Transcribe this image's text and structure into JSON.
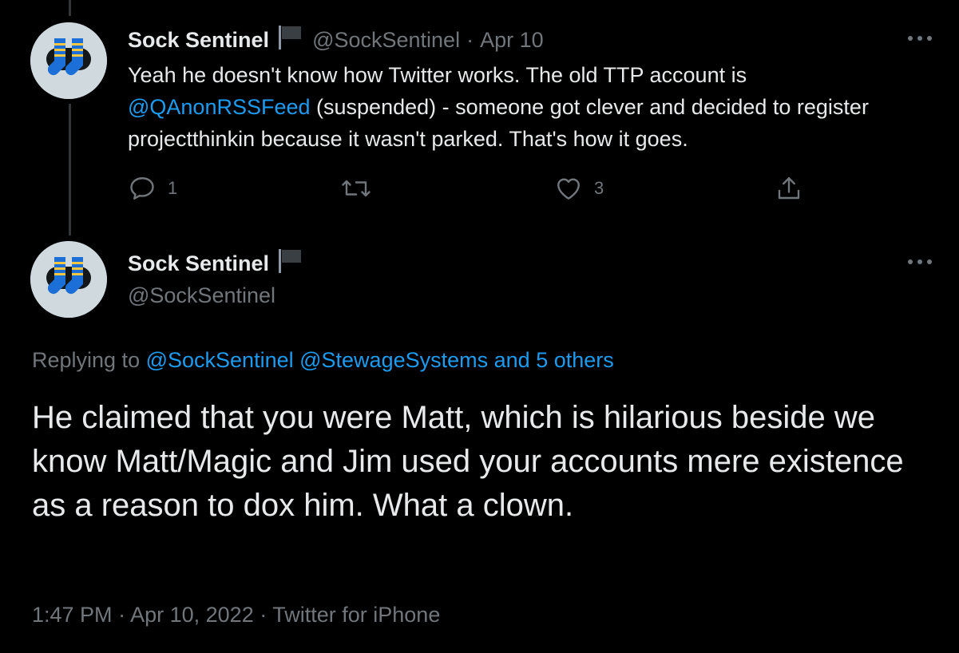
{
  "colors": {
    "background": "#000000",
    "text": "#e7e9ea",
    "muted": "#71767b",
    "link": "#1d9bf0",
    "thread_line": "#333639"
  },
  "tweet1": {
    "display_name": "Sock Sentinel",
    "handle": "@SockSentinel",
    "separator": "·",
    "date": "Apr 10",
    "text_line1": "Yeah he doesn't know how Twitter works. The old TTP account is",
    "mention": "@QAnonRSSFeed",
    "text_after_mention": " (suspended)  - someone got clever and decided to register projectthinkin because it wasn't parked.  That's how it goes.",
    "reply_count": "1",
    "retweet_count": "",
    "like_count": "3",
    "icons": [
      "avatar",
      "flag-icon",
      "more-icon",
      "reply-icon",
      "retweet-icon",
      "like-icon",
      "share-icon"
    ]
  },
  "tweet2": {
    "display_name": "Sock Sentinel",
    "handle": "@SockSentinel",
    "replying_prefix": "Replying to ",
    "replying_mention1": "@SockSentinel",
    "replying_mention2": "@StewageSystems",
    "replying_others": "and 5 others",
    "text": "He claimed that you were Matt, which is hilarious beside we know Matt/Magic and Jim used your accounts mere existence as a reason to dox him. What a clown.",
    "time": "1:47 PM",
    "date": "Apr 10, 2022",
    "source": "Twitter for iPhone",
    "separator": "·"
  }
}
